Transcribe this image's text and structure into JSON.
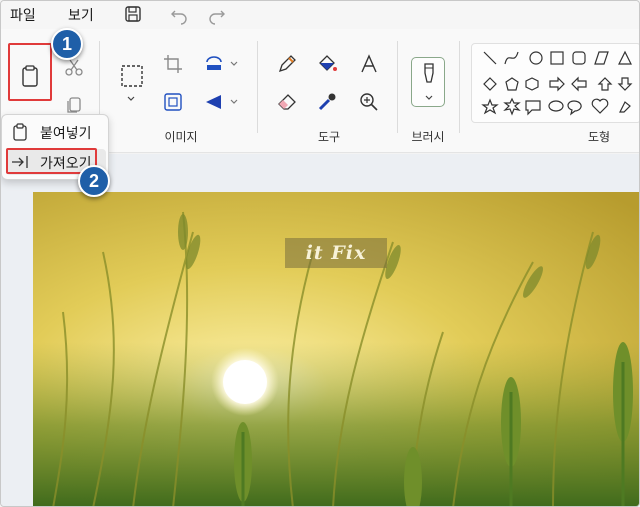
{
  "menu": {
    "file": "파일",
    "view": "보기"
  },
  "ribbon": {
    "groups": {
      "image": "이미지",
      "tools": "도구",
      "brush": "브러시",
      "shapes": "도형"
    }
  },
  "paste_menu": {
    "paste": "붙여넣기",
    "import": "가져오기"
  },
  "callouts": {
    "one": "1",
    "two": "2"
  },
  "watermark": "it Fix",
  "colors": {
    "highlight": "#e03a3a",
    "badge": "#1f5fa8",
    "stroke_color": "#2050c0",
    "fill_color": "#1e40b0"
  },
  "icons": {
    "save": "save-icon",
    "undo": "undo-icon",
    "redo": "redo-icon",
    "paste": "clipboard-icon",
    "cut": "scissors-icon",
    "copy": "copy-icon",
    "select": "selection-icon",
    "crop": "crop-icon",
    "rotate": "rotate-icon",
    "resize": "resize-icon",
    "flip": "flip-icon",
    "pencil": "pencil-icon",
    "fill": "fill-bucket-icon",
    "text": "text-icon",
    "eraser": "eraser-icon",
    "picker": "color-picker-icon",
    "zoom": "magnifier-icon",
    "brush": "brush-icon",
    "import": "import-arrow-icon"
  }
}
